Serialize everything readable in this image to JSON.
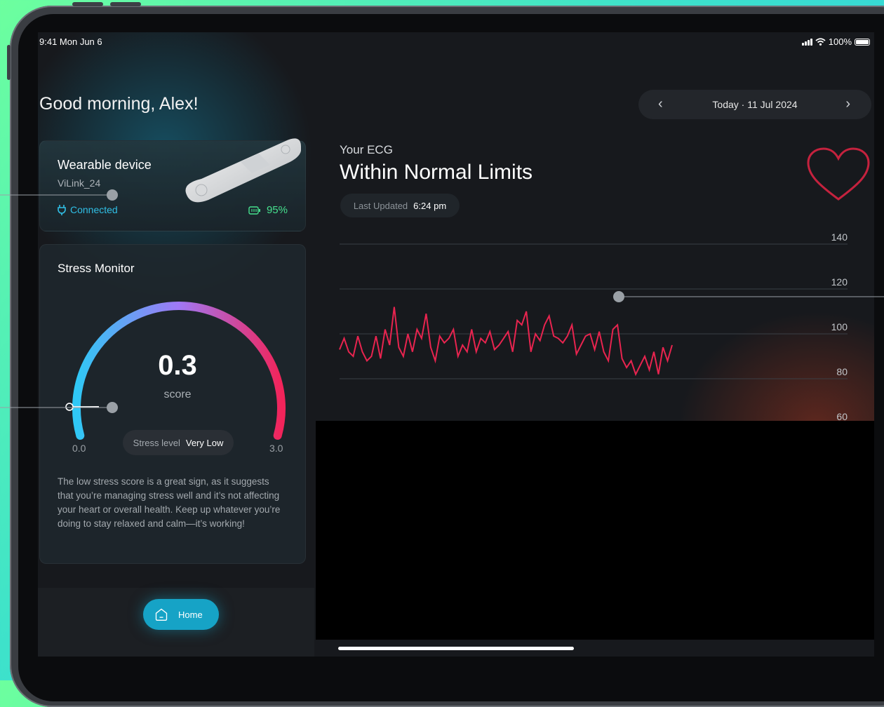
{
  "status_bar": {
    "time": "9:41  Mon Jun 6",
    "battery": "100%",
    "icons": [
      "signal-icon",
      "wifi-icon",
      "battery-icon"
    ]
  },
  "greeting": "Good morning, Alex!",
  "date_nav": {
    "label": "Today  ·  11 Jul 2024",
    "prev_icon": "chevron-left-icon",
    "next_icon": "chevron-right-icon"
  },
  "device_card": {
    "title": "Wearable device",
    "name": "ViLink_24",
    "status": "Connected",
    "battery": "95%",
    "status_color": "#30bfe6",
    "battery_color": "#46e08e"
  },
  "stress_card": {
    "title": "Stress Monitor",
    "score": "0.3",
    "score_label": "score",
    "score_value": 0.3,
    "min": "0.0",
    "max": "3.0",
    "level_key": "Stress level",
    "level_value": "Very Low",
    "description": "The low stress score is a great sign, as it suggests that you’re managing stress well and it’s not affecting your heart or overall health. Keep up whatever you’re doing to stay relaxed and calm—it’s working!"
  },
  "ecg": {
    "subtitle": "Your ECG",
    "title": "Within Normal Limits",
    "updated_key": "Last Updated",
    "updated_value": "6:24 pm",
    "line_color": "#e8244f"
  },
  "chart_data": {
    "type": "line",
    "ylim": [
      60,
      140
    ],
    "ytick_labels": [
      "140",
      "120",
      "100",
      "80",
      "60"
    ],
    "series": [
      {
        "values": [
          93,
          98,
          92,
          90,
          99,
          92,
          88,
          90,
          99,
          89,
          102,
          95,
          112,
          94,
          90,
          100,
          92,
          102,
          98,
          109,
          94,
          88,
          99,
          96,
          98,
          102,
          90,
          95,
          92,
          102,
          92,
          98,
          96,
          101,
          93,
          95,
          98,
          101,
          92,
          106,
          104,
          110,
          92,
          100,
          97,
          104,
          108,
          99,
          98,
          96,
          99,
          104,
          91,
          95,
          99,
          100,
          93,
          101,
          92,
          88,
          102,
          104,
          89,
          85,
          88,
          82,
          86,
          90,
          84,
          92,
          82,
          94,
          88,
          95
        ]
      }
    ]
  },
  "nav": {
    "home_label": "Home",
    "home_icon": "home-icon"
  }
}
